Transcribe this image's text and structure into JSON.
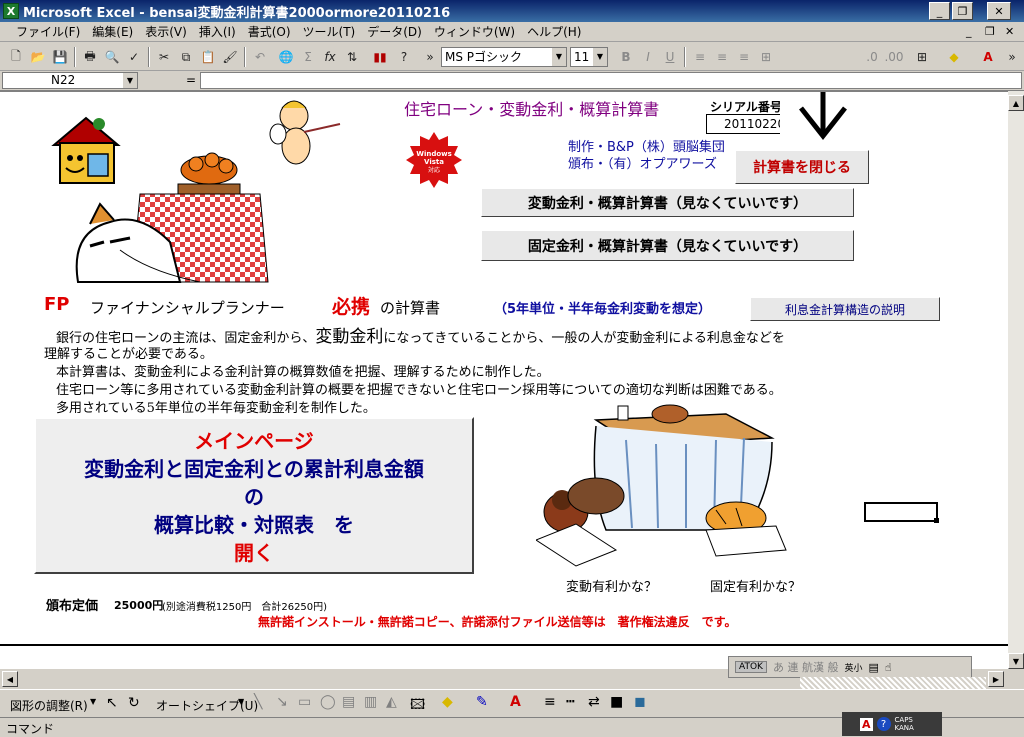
{
  "window": {
    "title": "Microsoft Excel - bensai変動金利計算書2000ormore20110216",
    "icon_label": "X",
    "minimize": "_",
    "restore": "❐",
    "close": "✕"
  },
  "menu": {
    "items": [
      "ファイル(F)",
      "編集(E)",
      "表示(V)",
      "挿入(I)",
      "書式(O)",
      "ツール(T)",
      "データ(D)",
      "ウィンドウ(W)",
      "ヘルプ(H)"
    ],
    "doc_minimize": "_",
    "doc_restore": "❐",
    "doc_close": "✕"
  },
  "toolbar": {
    "font_name": "MS Pゴシック",
    "font_size": "11",
    "bold": "B",
    "italic": "I",
    "underline": "U"
  },
  "formula_bar": {
    "name_box": "N22",
    "equals": "="
  },
  "sheet": {
    "heading": "住宅ローン・変動金利・概算計算書",
    "serial_label": "シリアル番号",
    "serial_value": "20110220",
    "maker": "制作・B&P（株）頭脳集団",
    "distributor": "頒布・（有）オプアワーズ",
    "vista_badge": "Windows Vista 対応",
    "close_button": "計算書を閉じる",
    "variable_button": "変動金利・概算計算書（見なくていいです）",
    "fixed_button": "固定金利・概算計算書（見なくていいです）",
    "fp_label": "FP",
    "fp_planner": "ファイナンシャルプランナー",
    "hikkei": "必携",
    "fp_calc": "の計算書",
    "fp_note": "（5年単位・半年毎金利変動を想定）",
    "structure_button": "利息金計算構造の説明",
    "para1a": "銀行の住宅ローンの主流は、固定金利から、",
    "para1b": "変動金利",
    "para1c": "になってきていることから、一般の人が変動金利による利息金などを",
    "para2": "理解することが必要である。",
    "para3": "本計算書は、変動金利による金利計算の概算数値を把握、理解するために制作した。",
    "para4": "住宅ローン等に多用されている変動金利計算の概要を把握できないと住宅ローン採用等についての適切な判断は困難である。",
    "para5": "多用されている5年単位の半年毎変動金利を制作した。",
    "main_page_l1": "メインページ",
    "main_page_l2": "変動金利と固定金利との累計利息金額",
    "main_page_l3": "の",
    "main_page_l4": "概算比較・対照表　を",
    "main_page_l5": "開く",
    "caption_variable": "変動有利かな？",
    "caption_fixed": "固定有利かな？",
    "price_label": "頒布定価",
    "price_value": "25000円",
    "price_note": "(別途消費税1250円　合計26250円)",
    "copyright": "無許諾インストール・無許諾コピー、許諾添付ファイル送信等は　著作権法違反　です。"
  },
  "ime_bar": {
    "atok": "ATOK",
    "chars": "あ 連 航漢 般",
    "mode": "英小"
  },
  "draw_toolbar": {
    "adjust": "図形の調整(R)",
    "autoshape": "オートシェイプ(U)"
  },
  "status": {
    "text": "コマンド",
    "caps": "CAPS",
    "kana": "KANA"
  },
  "colors": {
    "title_bar": "#0a246a",
    "heading_purple": "#800080",
    "red": "#e00000",
    "navy": "#000080",
    "maker_blue": "#1010a0"
  }
}
